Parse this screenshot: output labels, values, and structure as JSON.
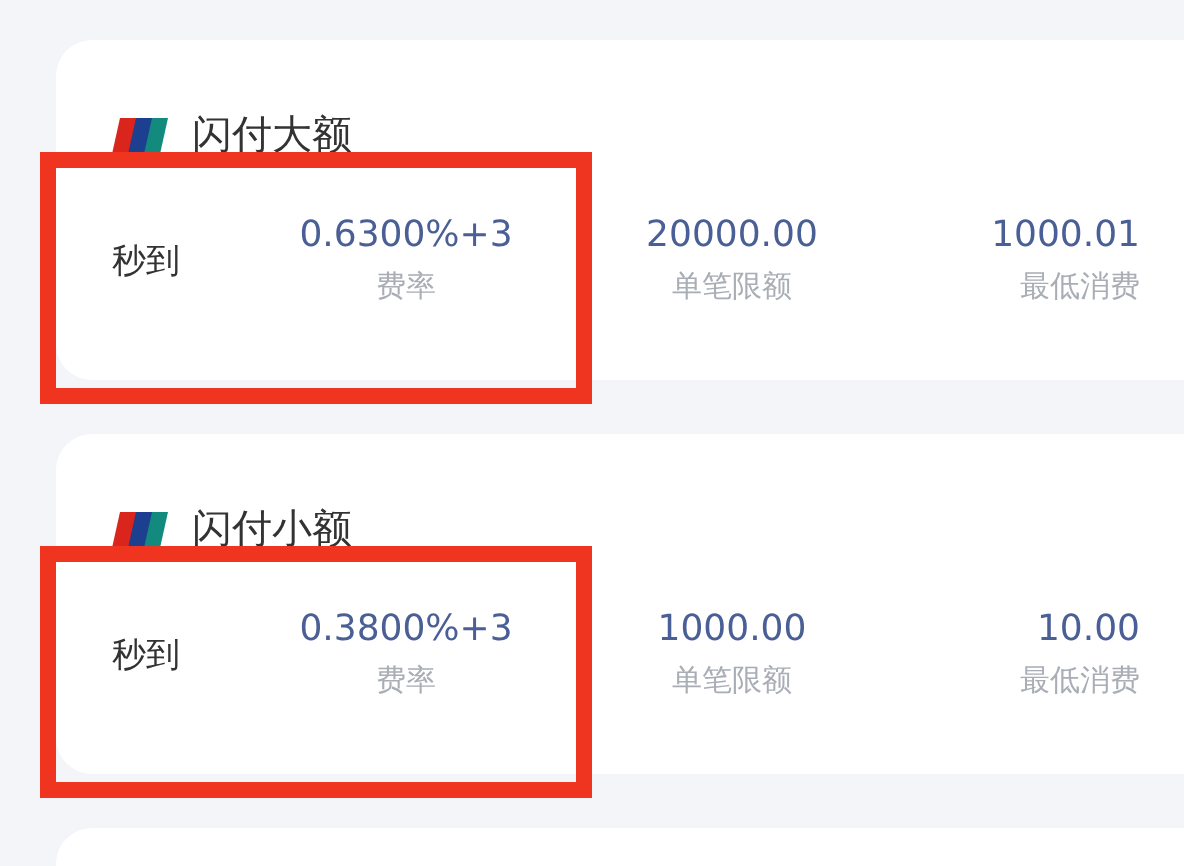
{
  "cards": [
    {
      "title": "闪付大额",
      "settle": "秒到",
      "highlighted": true,
      "stats": [
        {
          "value": "0.6300%+3",
          "label": "费率"
        },
        {
          "value": "20000.00",
          "label": "单笔限额"
        },
        {
          "value": "1000.01",
          "label": "最低消费"
        }
      ]
    },
    {
      "title": "闪付小额",
      "settle": "秒到",
      "highlighted": true,
      "stats": [
        {
          "value": "0.3800%+3",
          "label": "费率"
        },
        {
          "value": "1000.00",
          "label": "单笔限额"
        },
        {
          "value": "10.00",
          "label": "最低消费"
        }
      ]
    }
  ]
}
